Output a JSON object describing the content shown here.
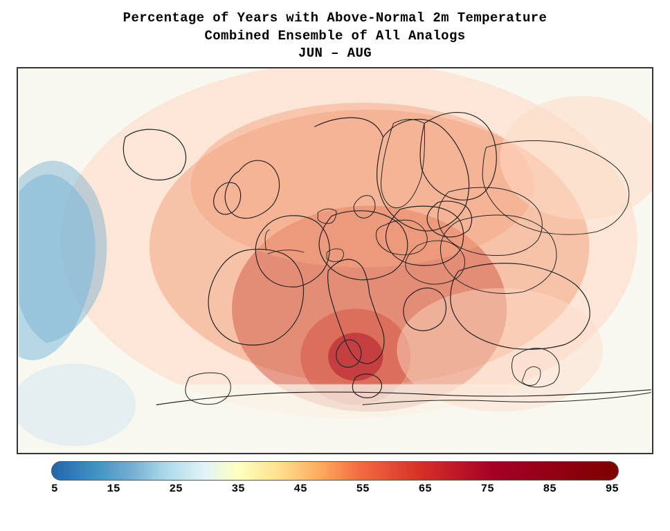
{
  "title": {
    "line1": "Percentage of Years with Above-Normal 2m Temperature",
    "line2": "Combined Ensemble of All Analogs",
    "line3": "JUN – AUG"
  },
  "colorbar": {
    "labels": [
      "5",
      "15",
      "25",
      "35",
      "45",
      "55",
      "65",
      "75",
      "85",
      "95"
    ]
  },
  "map": {
    "description": "Europe temperature anomaly percentage map"
  }
}
